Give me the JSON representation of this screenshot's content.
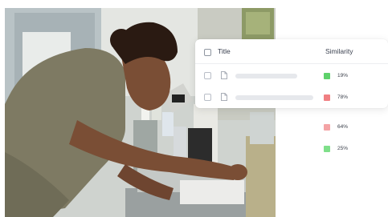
{
  "table": {
    "header": {
      "title": "Title",
      "similarity": "Similarity"
    },
    "rows": [
      {
        "similarity": "19%",
        "color": "#5ed16b"
      },
      {
        "similarity": "78%",
        "color": "#f07f82"
      },
      {
        "similarity": "64%",
        "color": "#f4a3a5"
      },
      {
        "similarity": "25%",
        "color": "#7fdf8a"
      }
    ]
  },
  "icons": {
    "document": "document-icon",
    "checkbox": "checkbox-icon"
  }
}
